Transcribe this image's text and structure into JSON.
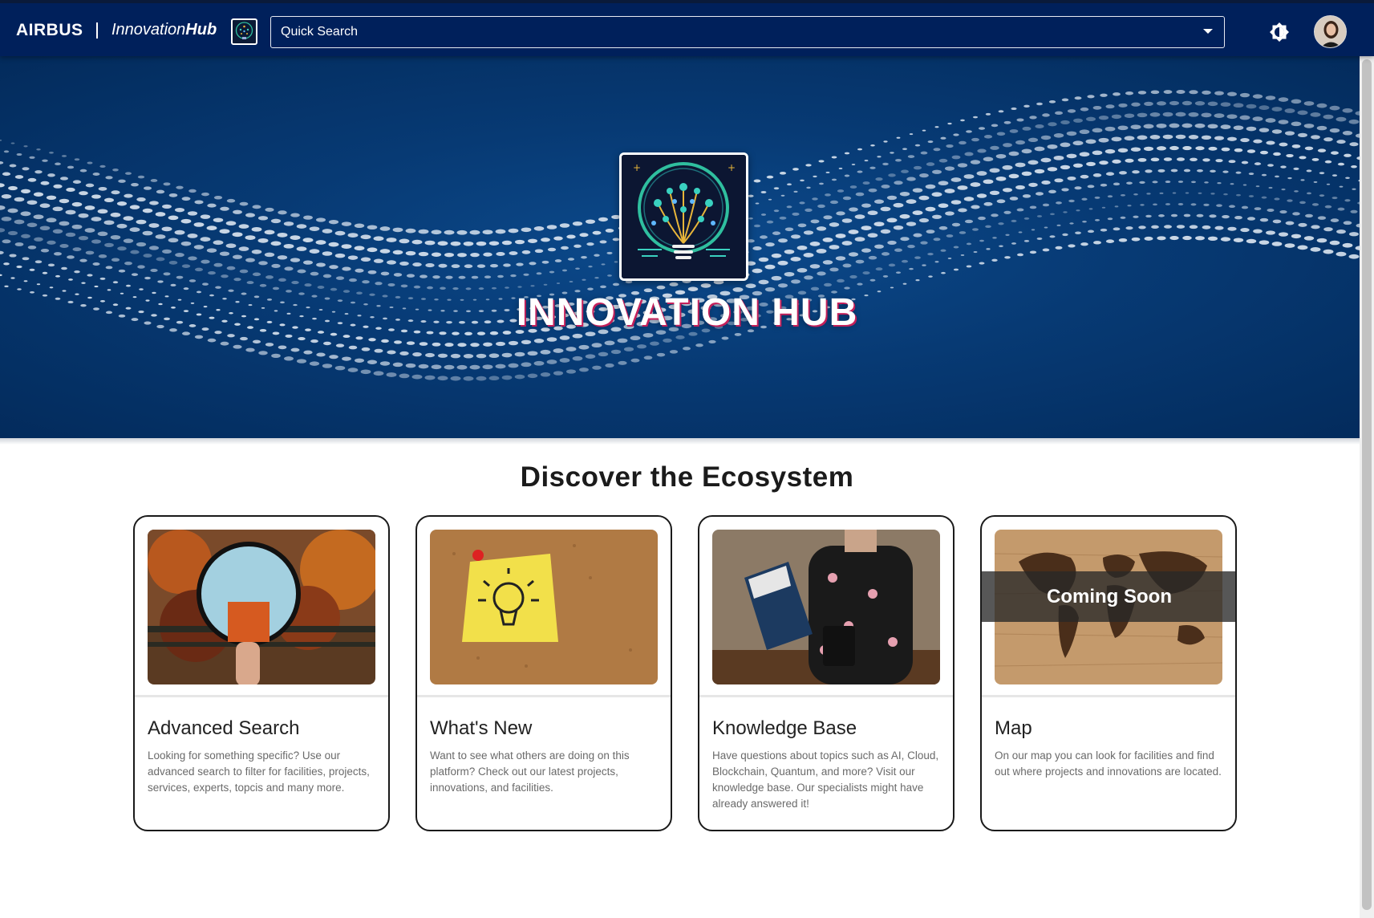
{
  "header": {
    "brand": "AIRBUS",
    "app_name_a": "Innovation",
    "app_name_b": "Hub",
    "search_placeholder": "Quick Search",
    "theme_icon": "brightness-icon",
    "avatar_icon": "user-avatar"
  },
  "hero": {
    "title": "INNOVATION HUB",
    "logo_icon": "lightbulb-network-icon"
  },
  "section": {
    "title": "Discover the Ecosystem"
  },
  "cards": [
    {
      "title": "Advanced Search",
      "description": "Looking for something specific? Use our advanced search to filter for facilities, projects, services, experts, topcis and many more.",
      "image": "magnifying-glass-autumn-photo"
    },
    {
      "title": "What's New",
      "description": "Want to see what others are doing on this platform? Check out our latest projects, innovations, and facilities.",
      "image": "sticky-note-lightbulb-photo"
    },
    {
      "title": "Knowledge Base",
      "description": "Have questions about topics such as AI, Cloud, Blockchain, Quantum, and more? Visit our knowledge base. Our specialists might have already answered it!",
      "image": "expert-reading-photo"
    },
    {
      "title": "Map",
      "description": "On our map you can look for facilities and find out where projects and innovations are located.",
      "image": "wooden-world-map-photo",
      "badge": "Coming Soon"
    }
  ],
  "colors": {
    "topbar": "#00205b",
    "hero": "#073a74",
    "accent_pink": "#c4205a"
  }
}
